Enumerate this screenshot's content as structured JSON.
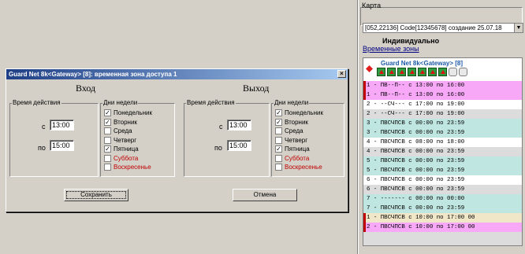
{
  "map_panel": {
    "legend": "Карта",
    "combo_text": "[052,22136] Code[12345678] создание 25.07.18",
    "combo_arrow": "▼",
    "subtitle": "Индивидуально",
    "zones_link": "Временные зоны"
  },
  "zone_list": {
    "header_title": "Guard Net 8k<Gateway> [8]",
    "rows": [
      {
        "text": "1 - ПВ--П-- с 13:00 по 16:00",
        "bg": "#f7a8f7",
        "selected": true
      },
      {
        "text": "1 - ПВ--П-- с 13:00 по 16:00",
        "bg": "#f7a8f7",
        "selected": true
      },
      {
        "text": "2 - --СЧ--- с 17:00 по 19:00",
        "bg": "#ffffff",
        "selected": false
      },
      {
        "text": "2 - --СЧ--- с 17:00 по 19:00",
        "bg": "#dcdcdc",
        "selected": false
      },
      {
        "text": "3 - ПВСЧПСВ с 00:00 по 23:59",
        "bg": "#bfe6e0",
        "selected": false
      },
      {
        "text": "3 - ПВСЧПСВ с 00:00 по 23:59",
        "bg": "#bfe6e0",
        "selected": false
      },
      {
        "text": "4 - ПВСЧПСВ с 08:00 по 18:00",
        "bg": "#ffffff",
        "selected": false
      },
      {
        "text": "4 - ПВСЧПСВ с 00:00 по 23:59",
        "bg": "#dcdcdc",
        "selected": false
      },
      {
        "text": "5 - ПВСЧПСВ с 00:00 по 23:59",
        "bg": "#bfe6e0",
        "selected": false
      },
      {
        "text": "5 - ПВСЧПСВ с 00:00 по 23:59",
        "bg": "#bfe6e0",
        "selected": false
      },
      {
        "text": "6 - ПВСЧПСВ с 00:00 по 23:59",
        "bg": "#ffffff",
        "selected": false
      },
      {
        "text": "6 - ПВСЧПСВ с 00:00 по 23:59",
        "bg": "#dcdcdc",
        "selected": false
      },
      {
        "text": "7 - ------- с 00:00 по 00:00",
        "bg": "#bfe6e0",
        "selected": false
      },
      {
        "text": "7 - ПВСЧПСВ с 00:00 по 23:59",
        "bg": "#bfe6e0",
        "selected": false
      },
      {
        "text": "1 - ПВСЧПСВ с 10:00 по 17:00 00",
        "bg": "#f0e6c8",
        "selected": true
      },
      {
        "text": "2 - ПВСЧПСВ с 10:00 по 17:00 00",
        "bg": "#f7a8f7",
        "selected": true
      }
    ],
    "extra_bg": "#dcdcdc"
  },
  "dialog": {
    "title": "Guard Net 8k<Gateway> [8]: временная зона доступа 1",
    "close": "×",
    "entry": {
      "heading": "Вход",
      "time_group": "Время действия",
      "from_label": "с",
      "from_value": "13:00",
      "to_label": "по",
      "to_value": "15:00",
      "days_group": "Дни недели",
      "days": [
        {
          "label": "Понедельник",
          "checked": true,
          "weekend": false
        },
        {
          "label": "Вторник",
          "checked": true,
          "weekend": false
        },
        {
          "label": "Среда",
          "checked": false,
          "weekend": false
        },
        {
          "label": "Четверг",
          "checked": false,
          "weekend": false
        },
        {
          "label": "Пятница",
          "checked": true,
          "weekend": false
        },
        {
          "label": "Суббота",
          "checked": false,
          "weekend": true
        },
        {
          "label": "Воскресенье",
          "checked": false,
          "weekend": true
        }
      ]
    },
    "exit": {
      "heading": "Выход",
      "time_group": "Время действия",
      "from_label": "с",
      "from_value": "13:00",
      "to_label": "по",
      "to_value": "15:00",
      "days_group": "Дни недели",
      "days": [
        {
          "label": "Понедельник",
          "checked": true,
          "weekend": false
        },
        {
          "label": "Вторник",
          "checked": true,
          "weekend": false
        },
        {
          "label": "Среда",
          "checked": false,
          "weekend": false
        },
        {
          "label": "Четверг",
          "checked": false,
          "weekend": false
        },
        {
          "label": "Пятница",
          "checked": true,
          "weekend": false
        },
        {
          "label": "Суббота",
          "checked": false,
          "weekend": true
        },
        {
          "label": "Воскресенье",
          "checked": false,
          "weekend": true
        }
      ]
    },
    "save_label": "Сохранить",
    "cancel_label": "Отмена"
  }
}
